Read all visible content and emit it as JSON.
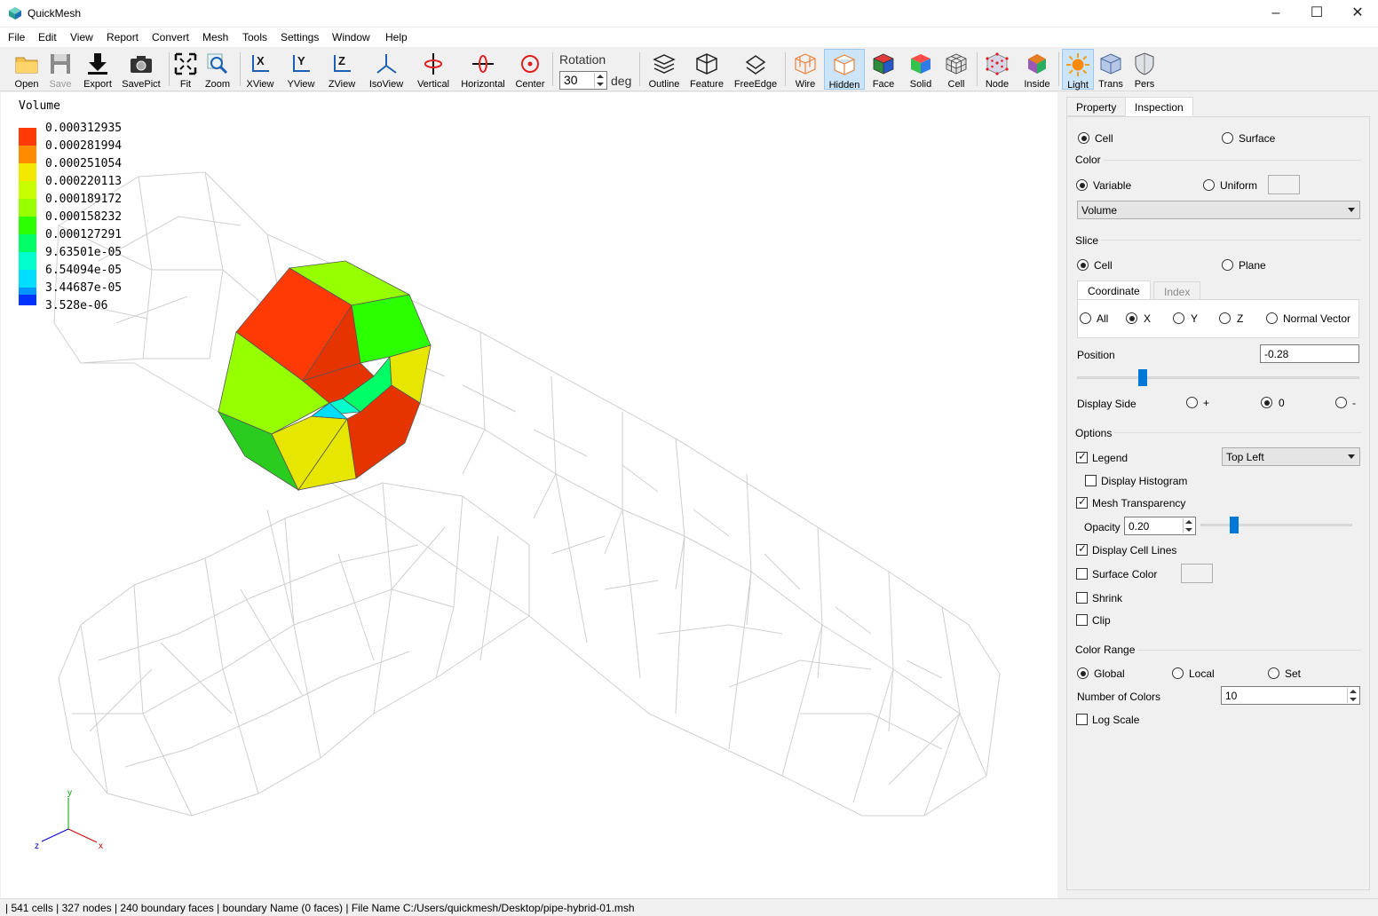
{
  "window": {
    "title": "QuickMesh"
  },
  "menu": [
    "File",
    "Edit",
    "View",
    "Report",
    "Convert",
    "Mesh",
    "Tools",
    "Settings",
    "Window",
    "Help"
  ],
  "toolbar": {
    "open": "Open",
    "save": "Save",
    "export": "Export",
    "savepict": "SavePict",
    "fit": "Fit",
    "zoom": "Zoom",
    "xview": "XView",
    "yview": "YView",
    "zview": "ZView",
    "isoview": "IsoView",
    "vertical": "Vertical",
    "horizontal": "Horizontal",
    "center": "Center",
    "rotation_label": "Rotation",
    "rotation_value": "30",
    "rotation_unit": "deg",
    "outline": "Outline",
    "feature": "Feature",
    "freeedge": "FreeEdge",
    "wire": "Wire",
    "hidden": "Hidden",
    "face": "Face",
    "solid": "Solid",
    "cell": "Cell",
    "node": "Node",
    "inside": "Inside",
    "light": "Light",
    "trans": "Trans",
    "pers": "Pers"
  },
  "legend": {
    "title": "Volume",
    "values": [
      "0.000312935",
      "0.000281994",
      "0.000251054",
      "0.000220113",
      "0.000189172",
      "0.000158232",
      "0.000127291",
      "9.63501e-05",
      "6.54094e-05",
      "3.44687e-05",
      "3.528e-06"
    ],
    "colors": [
      "#ff3a05",
      "#ff8c00",
      "#f2e800",
      "#c8ff00",
      "#96ff00",
      "#2bff00",
      "#00ff66",
      "#00ffcc",
      "#00ddff",
      "#0096ff",
      "#0033ff"
    ]
  },
  "axes": {
    "x": "x",
    "y": "y",
    "z": "z"
  },
  "panel": {
    "tabs": [
      "Property",
      "Inspection"
    ],
    "mode": {
      "cell": "Cell",
      "surface": "Surface"
    },
    "color": {
      "title": "Color",
      "variable": "Variable",
      "uniform": "Uniform",
      "selected": "Volume"
    },
    "slice": {
      "title": "Slice",
      "cell": "Cell",
      "plane": "Plane",
      "tabs": [
        "Coordinate",
        "Index"
      ],
      "axes": {
        "all": "All",
        "x": "X",
        "y": "Y",
        "z": "Z",
        "normal": "Normal Vector"
      },
      "position_label": "Position",
      "position_value": "-0.28",
      "side_label": "Display Side",
      "side_plus": "+",
      "side_zero": "0",
      "side_minus": "-"
    },
    "options": {
      "title": "Options",
      "legend": "Legend",
      "legend_pos": "Top Left",
      "histogram": "Display Histogram",
      "mesh_transparency": "Mesh Transparency",
      "opacity_label": "Opacity",
      "opacity_value": "0.20",
      "cell_lines": "Display Cell Lines",
      "surface_color": "Surface Color",
      "shrink": "Shrink",
      "clip": "Clip"
    },
    "color_range": {
      "title": "Color Range",
      "global": "Global",
      "local": "Local",
      "set": "Set",
      "num_colors_label": "Number of Colors",
      "num_colors_value": "10",
      "log_scale": "Log Scale"
    }
  },
  "statusbar": "| 541 cells | 327 nodes | 240 boundary faces |  boundary Name  (0 faces) | File Name C:/Users/quickmesh/Desktop/pipe-hybrid-01.msh"
}
